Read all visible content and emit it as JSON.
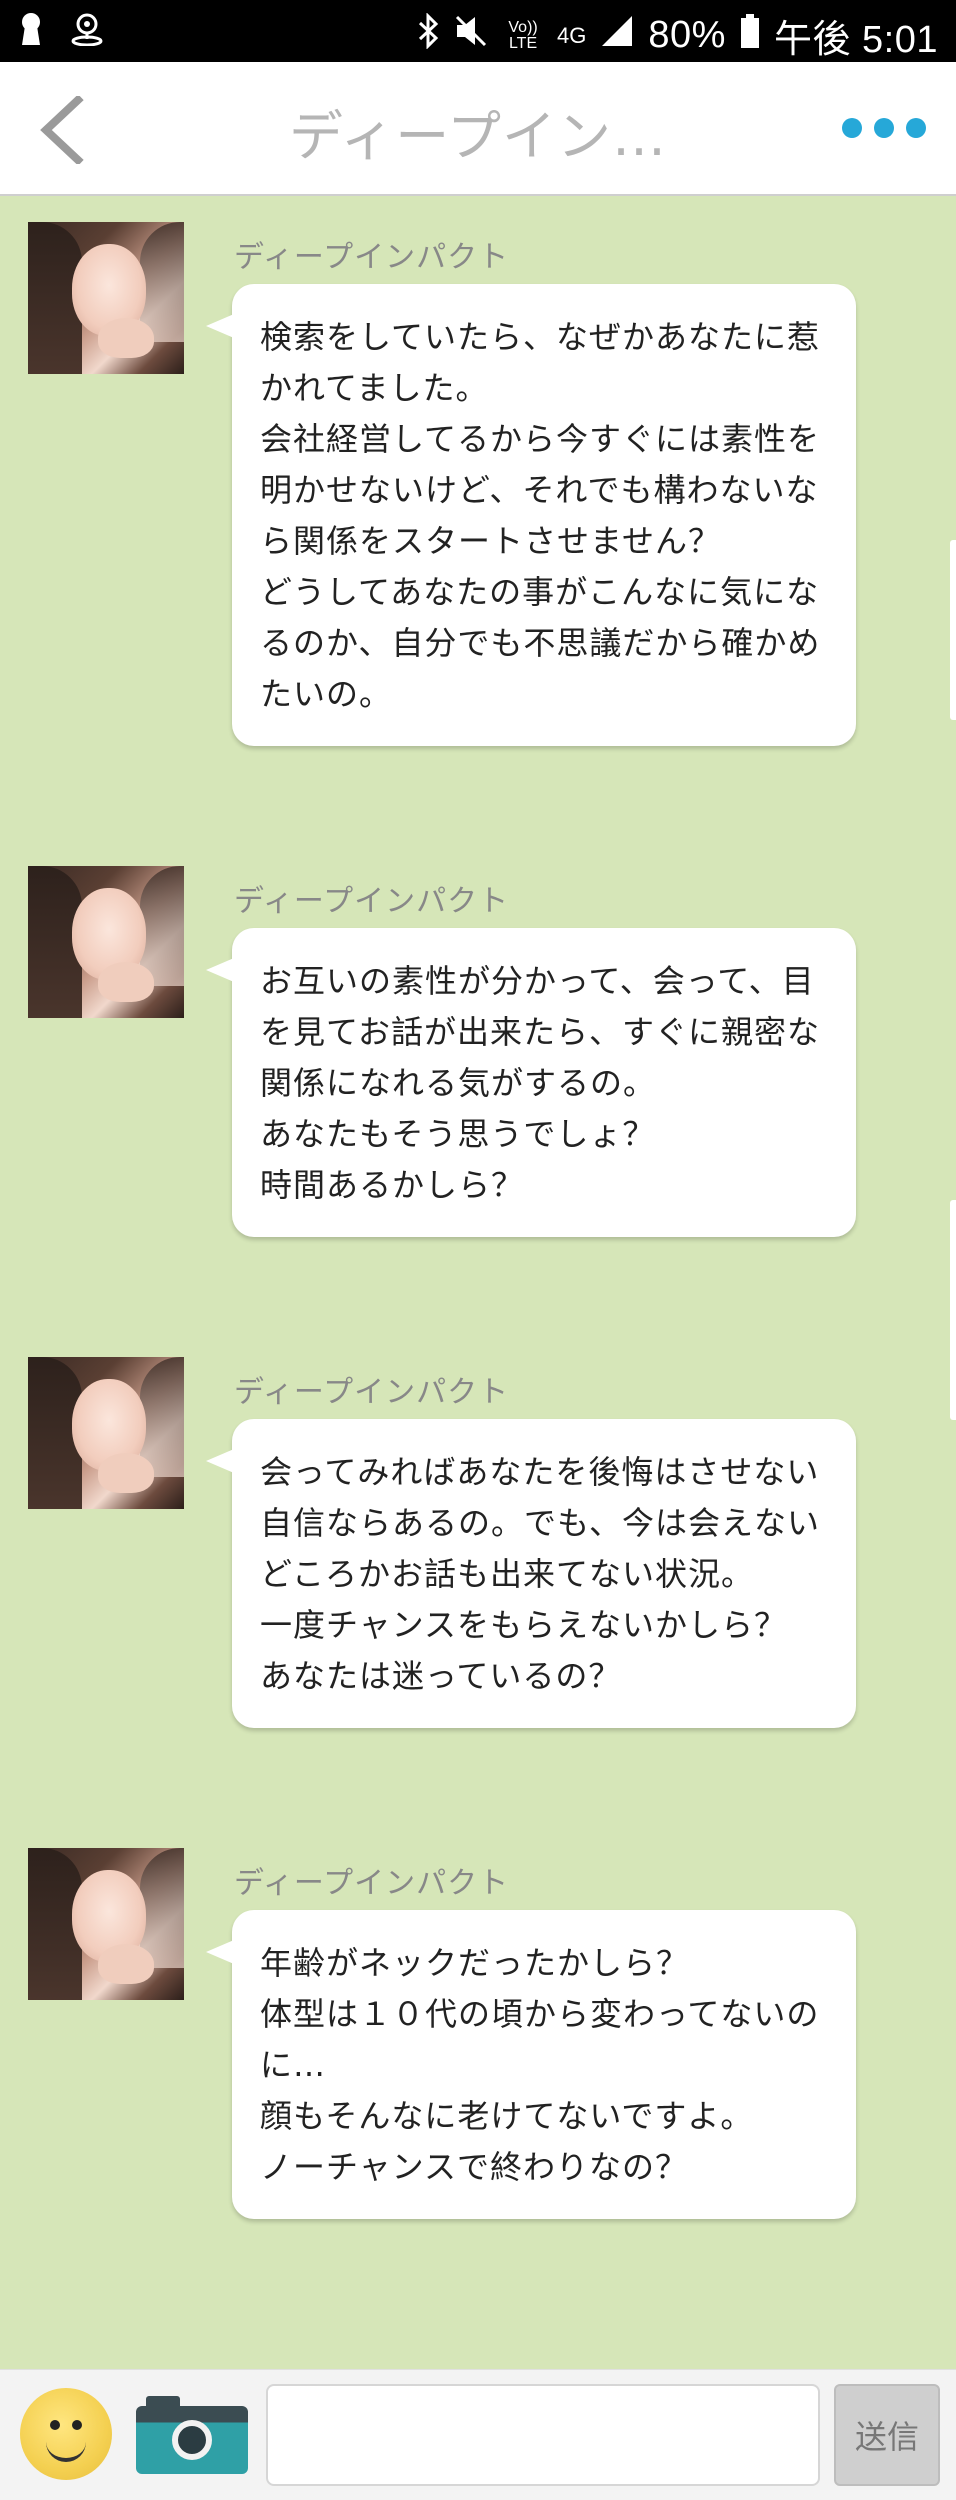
{
  "status_bar": {
    "battery": "80%",
    "time": "午後 5:01",
    "network": "4G",
    "volte": "Vo)) LTE",
    "icons": [
      "keyhole-icon",
      "location-icon",
      "bluetooth-icon",
      "mute-icon",
      "signal-icon",
      "battery-icon"
    ]
  },
  "header": {
    "title": "ディープイン…",
    "back_icon": "chevron-left-icon",
    "more_icon": "more-dots-icon",
    "accent": "#26a8d8"
  },
  "messages": [
    {
      "sender": "ディープインパクト",
      "lines": [
        "検索をしていたら、なぜかあなたに惹",
        "かれてました。",
        "会社経営してるから今すぐには素性を",
        "明かせないけど、それでも構わないな",
        "ら関係をスタートさせません？",
        "どうしてあなたの事がこんなに気にな",
        "るのか、自分でも不思議だから確かめ",
        "たいの。"
      ]
    },
    {
      "sender": "ディープインパクト",
      "lines": [
        "お互いの素性が分かって、会って、目",
        "を見てお話が出来たら、すぐに親密な",
        "関係になれる気がするの。",
        "あなたもそう思うでしょ？",
        "時間あるかしら？"
      ]
    },
    {
      "sender": "ディープインパクト",
      "lines": [
        "会ってみればあなたを後悔はさせない",
        "自信ならあるの。でも、今は会えない",
        "どころかお話も出来てない状況。",
        "一度チャンスをもらえないかしら？",
        "あなたは迷っているの？"
      ]
    },
    {
      "sender": "ディープインパクト",
      "lines": [
        "年齢がネックだったかしら？",
        "体型は１０代の頃から変わってないの",
        "に…",
        "顔もそんなに老けてないですよ。",
        "ノーチャンスで終わりなの？"
      ]
    }
  ],
  "input_bar": {
    "placeholder": "",
    "send_label": "送信",
    "emoji_icon": "smiley-icon",
    "camera_icon": "camera-icon"
  },
  "colors": {
    "background": "#d6e6b8",
    "bubble": "#ffffff",
    "sender_text": "#888888"
  }
}
